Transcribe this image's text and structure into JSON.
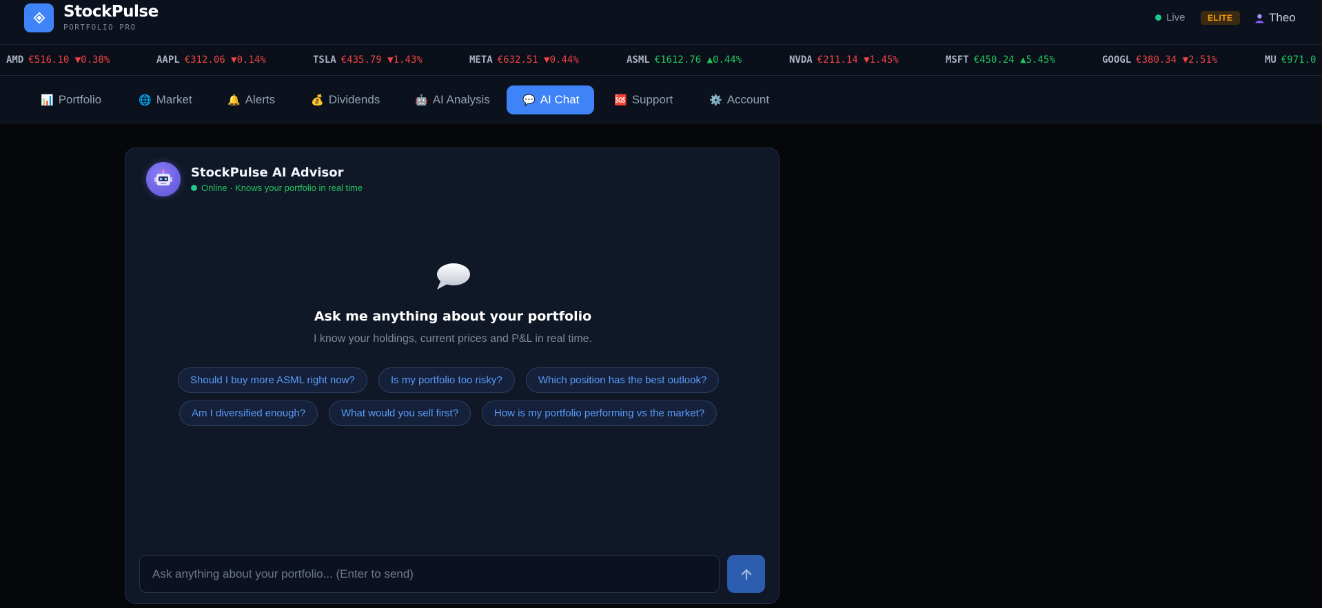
{
  "brand": {
    "name": "StockPulse",
    "subtitle": "PORTFOLIO PRO"
  },
  "header": {
    "status_label": "Live",
    "badge": "ELITE",
    "user_name": "Theo"
  },
  "ticker": [
    {
      "symbol": "AMD",
      "price": "€516.10",
      "change": "▼0.38%",
      "direction": "down"
    },
    {
      "symbol": "AAPL",
      "price": "€312.06",
      "change": "▼0.14%",
      "direction": "down"
    },
    {
      "symbol": "TSLA",
      "price": "€435.79",
      "change": "▼1.43%",
      "direction": "down"
    },
    {
      "symbol": "META",
      "price": "€632.51",
      "change": "▼0.44%",
      "direction": "down"
    },
    {
      "symbol": "ASML",
      "price": "€1612.76",
      "change": "▲0.44%",
      "direction": "up"
    },
    {
      "symbol": "NVDA",
      "price": "€211.14",
      "change": "▼1.45%",
      "direction": "down"
    },
    {
      "symbol": "MSFT",
      "price": "€450.24",
      "change": "▲5.45%",
      "direction": "up"
    },
    {
      "symbol": "GOOGL",
      "price": "€380.34",
      "change": "▼2.51%",
      "direction": "down"
    },
    {
      "symbol": "MU",
      "price": "€971.0",
      "change": "",
      "direction": "up"
    }
  ],
  "nav": {
    "tabs": [
      {
        "label": "Portfolio",
        "icon": "📊",
        "icon_name": "bar-chart-icon"
      },
      {
        "label": "Market",
        "icon": "🌐",
        "icon_name": "globe-icon"
      },
      {
        "label": "Alerts",
        "icon": "🔔",
        "icon_name": "bell-icon"
      },
      {
        "label": "Dividends",
        "icon": "💰",
        "icon_name": "money-bag-icon"
      },
      {
        "label": "AI Analysis",
        "icon": "🤖",
        "icon_name": "robot-icon"
      },
      {
        "label": "AI Chat",
        "icon": "💬",
        "icon_name": "chat-bubble-icon",
        "active": true
      },
      {
        "label": "Support",
        "icon": "🆘",
        "icon_name": "sos-icon"
      },
      {
        "label": "Account",
        "icon": "⚙️",
        "icon_name": "gear-icon"
      }
    ]
  },
  "chat": {
    "advisor_name": "StockPulse AI Advisor",
    "status_text": "Online · Knows your portfolio in real time",
    "empty_title": "Ask me anything about your portfolio",
    "empty_subtitle": "I know your holdings, current prices and P&L in real time.",
    "suggestions": [
      "Should I buy more ASML right now?",
      "Is my portfolio too risky?",
      "Which position has the best outlook?",
      "Am I diversified enough?",
      "What would you sell first?",
      "How is my portfolio performing vs the market?"
    ],
    "input_placeholder": "Ask anything about your portfolio... (Enter to send)"
  },
  "colors": {
    "accent": "#3f83f8",
    "up": "#22c55e",
    "down": "#ef4444",
    "online": "#1ec98a",
    "elite_badge": "#f59e0b"
  }
}
